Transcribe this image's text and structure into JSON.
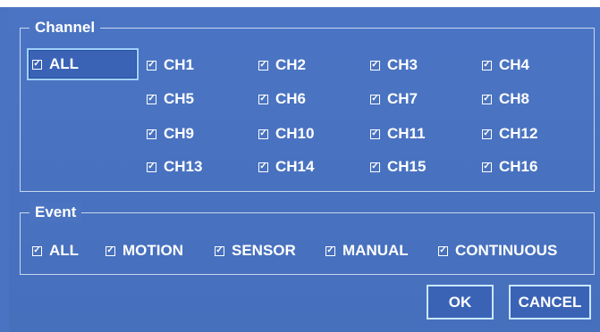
{
  "channel": {
    "title": "Channel",
    "all_label": "ALL",
    "channels": [
      "CH1",
      "CH2",
      "CH3",
      "CH4",
      "CH5",
      "CH6",
      "CH7",
      "CH8",
      "CH9",
      "CH10",
      "CH11",
      "CH12",
      "CH13",
      "CH14",
      "CH15",
      "CH16"
    ]
  },
  "event": {
    "title": "Event",
    "options": [
      "ALL",
      "MOTION",
      "SENSOR",
      "MANUAL",
      "CONTINUOUS"
    ]
  },
  "buttons": {
    "ok": "OK",
    "cancel": "CANCEL"
  },
  "checkbox_glyph": "✓",
  "colors": {
    "background": "#4a74c2",
    "selection_outline": "#9fd2ff",
    "text": "#ffffff"
  }
}
